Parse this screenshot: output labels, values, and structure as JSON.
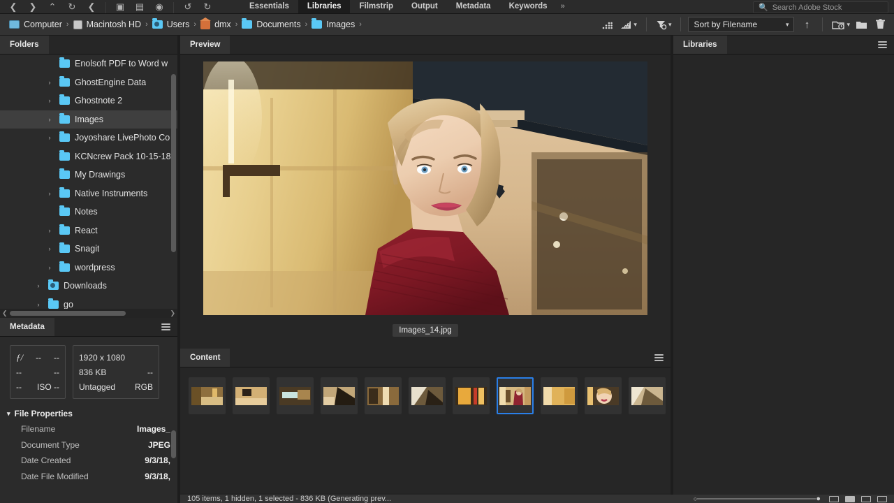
{
  "topbar": {
    "nav_icons": [
      "back-arrow",
      "forward-arrow",
      "up-arrow",
      "rotate-ccw",
      "rotate-cw"
    ],
    "tool_icons": [
      "camera-import",
      "open-recent",
      "refine"
    ],
    "rotate_icons": [
      "rotate-left",
      "rotate-right"
    ],
    "workspaces": [
      {
        "label": "Essentials",
        "active": false
      },
      {
        "label": "Libraries",
        "active": true
      },
      {
        "label": "Filmstrip",
        "active": false
      },
      {
        "label": "Output",
        "active": false
      },
      {
        "label": "Metadata",
        "active": false
      },
      {
        "label": "Keywords",
        "active": false
      }
    ],
    "workspace_more": "»",
    "stock_search_placeholder": "Search Adobe Stock"
  },
  "pathbar": {
    "crumbs": [
      {
        "label": "Computer",
        "icon": "monitor-icon"
      },
      {
        "label": "Macintosh HD",
        "icon": "drive-icon"
      },
      {
        "label": "Users",
        "icon": "folder-icon"
      },
      {
        "label": "dmx",
        "icon": "home-icon"
      },
      {
        "label": "Documents",
        "icon": "folder-icon"
      },
      {
        "label": "Images",
        "icon": "folder-icon"
      }
    ],
    "separator": "›",
    "tools": {
      "rating_filter": "rating-filter-icon",
      "rating_sort": "rating-sort-icon",
      "filter": "filter-funnel-icon",
      "sort_label": "Sort by Filename",
      "sort_direction": "↑",
      "recent_folder": "recent-folder-icon",
      "new_folder": "new-folder-icon",
      "delete": "trash-icon"
    }
  },
  "folders": {
    "title": "Folders",
    "items": [
      {
        "label": "Enolsoft PDF to Word w",
        "indent": 2,
        "twisty": "",
        "selected": false,
        "icon": "folder-icon"
      },
      {
        "label": "GhostEngine Data",
        "indent": 2,
        "twisty": "›",
        "selected": false,
        "icon": "folder-icon"
      },
      {
        "label": "Ghostnote 2",
        "indent": 2,
        "twisty": "›",
        "selected": false,
        "icon": "folder-icon"
      },
      {
        "label": "Images",
        "indent": 2,
        "twisty": "›",
        "selected": true,
        "icon": "folder-icon"
      },
      {
        "label": "Joyoshare LivePhoto Co",
        "indent": 2,
        "twisty": "›",
        "selected": false,
        "icon": "folder-icon"
      },
      {
        "label": "KCNcrew Pack 10-15-18",
        "indent": 2,
        "twisty": "",
        "selected": false,
        "icon": "folder-icon"
      },
      {
        "label": "My Drawings",
        "indent": 2,
        "twisty": "",
        "selected": false,
        "icon": "folder-icon"
      },
      {
        "label": "Native Instruments",
        "indent": 2,
        "twisty": "›",
        "selected": false,
        "icon": "folder-icon"
      },
      {
        "label": "Notes",
        "indent": 2,
        "twisty": "",
        "selected": false,
        "icon": "folder-icon"
      },
      {
        "label": "React",
        "indent": 2,
        "twisty": "›",
        "selected": false,
        "icon": "folder-icon"
      },
      {
        "label": "Snagit",
        "indent": 2,
        "twisty": "›",
        "selected": false,
        "icon": "folder-icon"
      },
      {
        "label": "wordpress",
        "indent": 2,
        "twisty": "›",
        "selected": false,
        "icon": "folder-icon"
      },
      {
        "label": "Downloads",
        "indent": 1,
        "twisty": "›",
        "selected": false,
        "icon": "folder-clock-icon"
      },
      {
        "label": "go",
        "indent": 1,
        "twisty": "›",
        "selected": false,
        "icon": "folder-icon"
      }
    ]
  },
  "metadata": {
    "title": "Metadata",
    "placard_left": [
      {
        "left": "ƒ/",
        "mid": "--",
        "right": "--"
      },
      {
        "left": "",
        "mid": "--",
        "right": "--"
      },
      {
        "left": "",
        "mid": "--",
        "right": "ISO --"
      }
    ],
    "placard_right": [
      {
        "left": "1920 x 1080",
        "right": ""
      },
      {
        "left": "836 KB",
        "right": "--"
      },
      {
        "left": "Untagged",
        "right": "RGB"
      }
    ],
    "file_properties": {
      "title": "File Properties",
      "rows": [
        {
          "key": "Filename",
          "value": "Images_"
        },
        {
          "key": "Document Type",
          "value": "JPEG"
        },
        {
          "key": "Date Created",
          "value": "9/3/18,"
        },
        {
          "key": "Date File Modified",
          "value": "9/3/18,"
        }
      ]
    }
  },
  "preview": {
    "title": "Preview",
    "filename": "Images_14.jpg"
  },
  "content": {
    "title": "Content",
    "thumbnails": [
      {
        "index": 1,
        "selected": false
      },
      {
        "index": 2,
        "selected": false
      },
      {
        "index": 3,
        "selected": false
      },
      {
        "index": 4,
        "selected": false
      },
      {
        "index": 5,
        "selected": false
      },
      {
        "index": 6,
        "selected": false
      },
      {
        "index": 7,
        "selected": false
      },
      {
        "index": 8,
        "selected": true
      },
      {
        "index": 9,
        "selected": false
      },
      {
        "index": 10,
        "selected": false
      },
      {
        "index": 11,
        "selected": false
      }
    ]
  },
  "libraries": {
    "title": "Libraries"
  },
  "statusbar": {
    "text": "105 items, 1 hidden, 1 selected - 836 KB (Generating prev..."
  },
  "colors": {
    "selection_blue": "#2a7fe8",
    "folder_blue": "#5ac8f5",
    "panel_bg": "#262626",
    "tree_bg": "#2b2b2b",
    "pathbar_bg": "#333333"
  }
}
